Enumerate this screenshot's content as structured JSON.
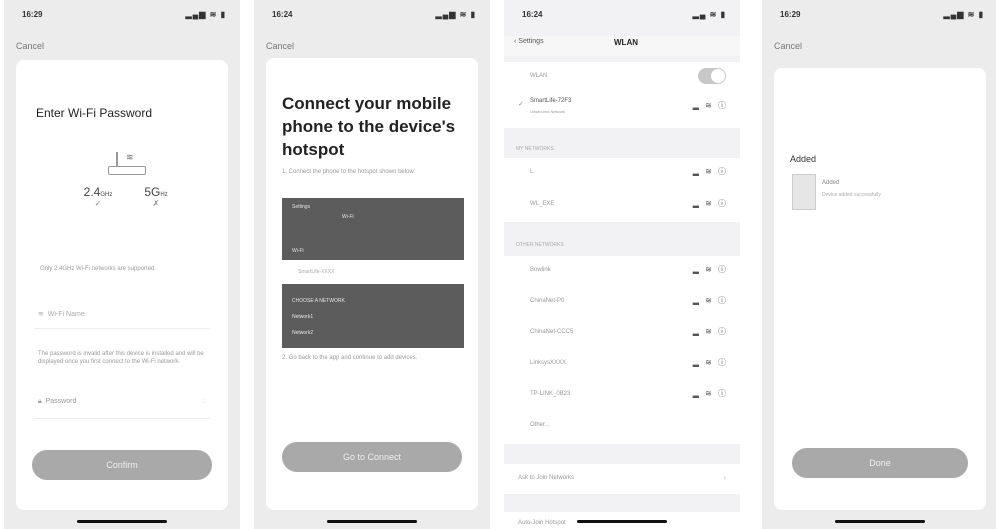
{
  "phone1": {
    "time": "16:29",
    "signal": "▂▄▆ ≋ ▮",
    "cancel": "Cancel",
    "title": "Enter Wi-Fi Password",
    "band_24": "2.4",
    "band_24_unit": "GHz",
    "band_24_mark": "✓",
    "band_5": "5G",
    "band_5_unit": "Hz",
    "band_5_mark": "✗",
    "note": "Only 2.4GHz Wi-Fi networks are supported.",
    "wifi_placeholder": "Wi-Fi Name",
    "warning": "The password is invalid after this device is installed and will be displayed once you first connect to the Wi-Fi network.",
    "password_placeholder": "Password",
    "confirm": "Confirm"
  },
  "phone2": {
    "time": "16:24",
    "signal": "▂▄▆ ≋ ▮",
    "cancel": "Cancel",
    "title": "Connect your mobile phone to the device's hotspot",
    "step1": "1. Connect the phone to the hotspot shown below:",
    "step2": "2. Go back to the app and continue to add devices.",
    "shot_rows": [
      "Settings",
      "Wi-Fi",
      "Wi-Fi",
      "SmartLife-XXXX",
      "CHOOSE A NETWORK",
      "Network1",
      "Network2"
    ],
    "button": "Go to Connect"
  },
  "phone3": {
    "time": "16:24",
    "signal": "▂▄ ≋ ▮",
    "back": "Settings",
    "title": "WLAN",
    "wlan": "WLAN",
    "current": "SmartLife-72F3",
    "current_sub": "Unsecured Network",
    "my_networks": "MY NETWORKS",
    "my_list": [
      "L",
      "WL_EXE"
    ],
    "other_networks": "OTHER NETWORKS",
    "other_list": [
      "Bowlink",
      "ChinaNet-P0",
      "ChinaNet-CCC5",
      "LinksysXXXX",
      "TP-LINK_0B23",
      "Other..."
    ],
    "wifi_icons": "▂ ≋ ⓘ",
    "ask": "Ask to Join Networks",
    "auto": "Auto-Join Hotspot"
  },
  "phone4": {
    "time": "16:29",
    "signal": "▂▄▆ ≋ ▮",
    "cancel": "Cancel",
    "added": "Added",
    "device": "Added",
    "device_sub": "Device added successfully",
    "done": "Done"
  }
}
